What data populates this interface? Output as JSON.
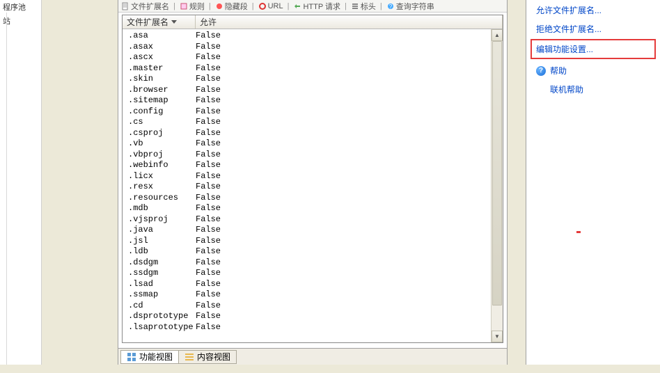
{
  "left_fragment": {
    "line1": "程序池",
    "line2": "站"
  },
  "toolbar": {
    "item1": "文件扩展名",
    "item2": "规则",
    "item3": "隐藏段",
    "item4": "URL",
    "item5": "HTTP 请求",
    "item6": "标头",
    "item7": "查询字符串"
  },
  "list": {
    "header_ext": "文件扩展名",
    "header_allow": "允许",
    "rows": [
      {
        "ext": ".asa",
        "allow": "False"
      },
      {
        "ext": ".asax",
        "allow": "False"
      },
      {
        "ext": ".ascx",
        "allow": "False"
      },
      {
        "ext": ".master",
        "allow": "False"
      },
      {
        "ext": ".skin",
        "allow": "False"
      },
      {
        "ext": ".browser",
        "allow": "False"
      },
      {
        "ext": ".sitemap",
        "allow": "False"
      },
      {
        "ext": ".config",
        "allow": "False"
      },
      {
        "ext": ".cs",
        "allow": "False"
      },
      {
        "ext": ".csproj",
        "allow": "False"
      },
      {
        "ext": ".vb",
        "allow": "False"
      },
      {
        "ext": ".vbproj",
        "allow": "False"
      },
      {
        "ext": ".webinfo",
        "allow": "False"
      },
      {
        "ext": ".licx",
        "allow": "False"
      },
      {
        "ext": ".resx",
        "allow": "False"
      },
      {
        "ext": ".resources",
        "allow": "False"
      },
      {
        "ext": ".mdb",
        "allow": "False"
      },
      {
        "ext": ".vjsproj",
        "allow": "False"
      },
      {
        "ext": ".java",
        "allow": "False"
      },
      {
        "ext": ".jsl",
        "allow": "False"
      },
      {
        "ext": ".ldb",
        "allow": "False"
      },
      {
        "ext": ".dsdgm",
        "allow": "False"
      },
      {
        "ext": ".ssdgm",
        "allow": "False"
      },
      {
        "ext": ".lsad",
        "allow": "False"
      },
      {
        "ext": ".ssmap",
        "allow": "False"
      },
      {
        "ext": ".cd",
        "allow": "False"
      },
      {
        "ext": ".dsprototype",
        "allow": "False"
      },
      {
        "ext": ".lsaprototype",
        "allow": "False"
      }
    ]
  },
  "tabs": {
    "features_view": "功能视图",
    "content_view": "内容视图"
  },
  "actions": {
    "allow_ext": "允许文件扩展名...",
    "deny_ext": "拒绝文件扩展名...",
    "edit_feature": "编辑功能设置...",
    "help": "帮助",
    "online_help": "联机帮助"
  }
}
